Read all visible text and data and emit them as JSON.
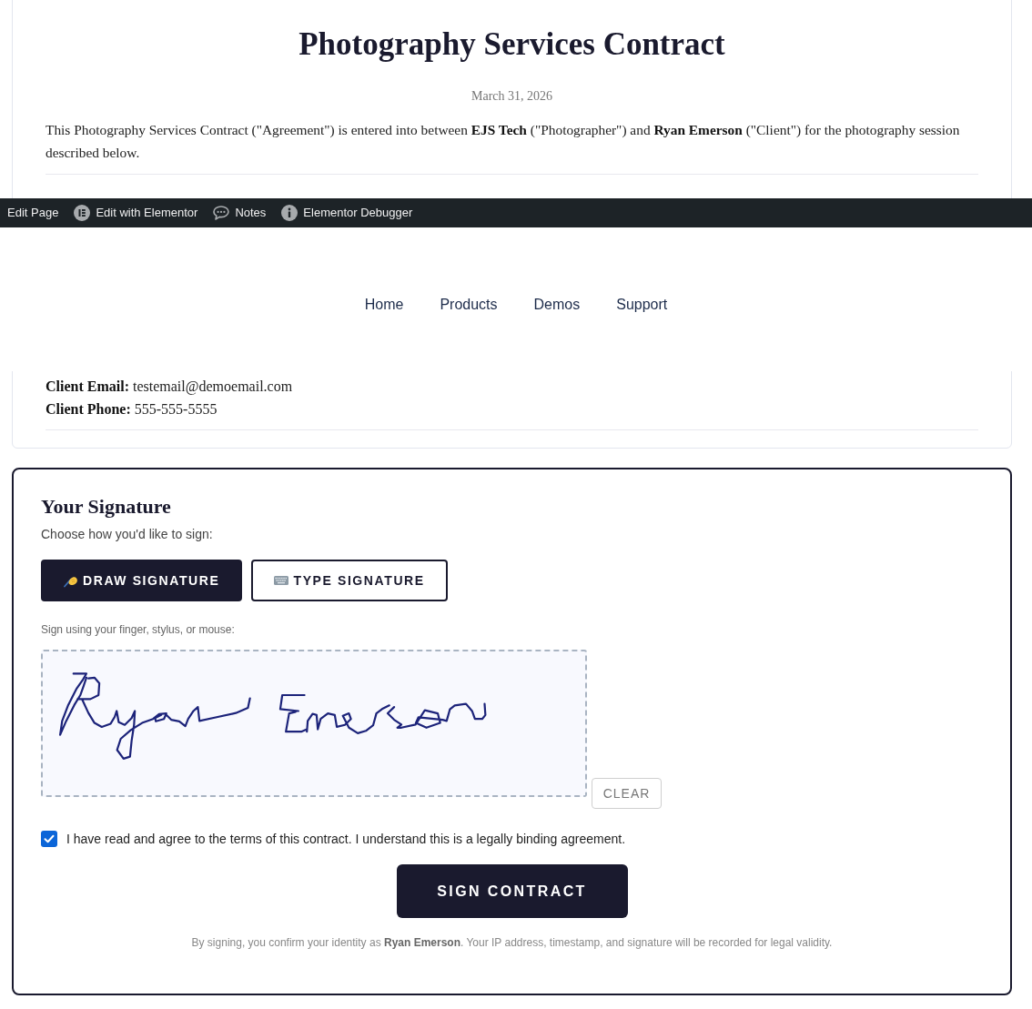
{
  "contract": {
    "title": "Photography Services Contract",
    "date": "March 31, 2026",
    "intro": "This Photography Services Contract (\"Agreement\") is entered into between **EJS Tech** (\"Photographer\") and **Ryan Emerson** (\"Client\") for the photography session described below.",
    "details": [
      "**Client Email:** testemail@demoemail.com",
      "**Client Phone:** 555-555-5555"
    ]
  },
  "admin_bar": {
    "items": [
      {
        "kind": "plain",
        "label": "Edit Page"
      },
      {
        "kind": "builder",
        "label": "Edit with Elementor"
      },
      {
        "kind": "comments",
        "label": "Notes"
      },
      {
        "kind": "info",
        "label": "Elementor Debugger"
      }
    ]
  },
  "nav": {
    "links": [
      "Home",
      "Products",
      "Demos",
      "Support"
    ]
  },
  "signature": {
    "title": "Your Signature",
    "prompt": "Choose how you'd like to sign:",
    "modes": [
      {
        "kind": "draw",
        "label": "DRAW SIGNATURE",
        "selected": true
      },
      {
        "kind": "type",
        "label": "TYPE SIGNATURE",
        "selected": false
      }
    ],
    "hint": "Sign using your finger, stylus, or mouse:",
    "clear": "CLEAR",
    "agreement": {
      "label": "I have read and agree to the terms of this contract. I understand this is a legally binding agreement.",
      "checked": true
    },
    "submit": "SIGN CONTRACT",
    "note": "By signing, you confirm your identity as **Ryan Emerson**. Your IP address, timestamp, and signature will be recorded for legal validity."
  }
}
